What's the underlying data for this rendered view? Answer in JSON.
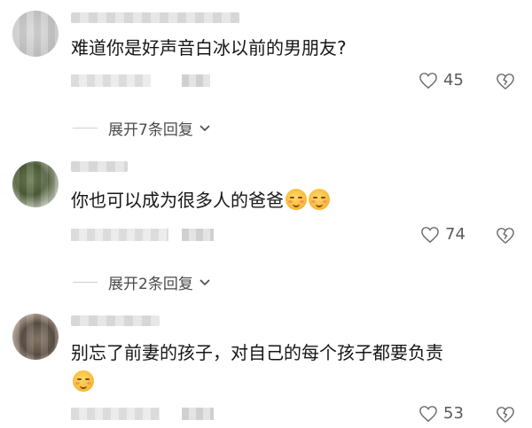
{
  "comments": [
    {
      "text": "难道你是好声音白冰以前的男朋友?",
      "likes": "45",
      "replies_label": "展开7条回复"
    },
    {
      "text": "你也可以成为很多人的爸爸",
      "likes": "74",
      "replies_label": "展开2条回复"
    },
    {
      "text": "别忘了前妻的孩子，对自己的每个孩子都要负责",
      "likes": "53"
    }
  ],
  "icons": {
    "like": "heart-outline-icon",
    "dislike": "broken-heart-icon",
    "expand": "chevron-down-icon"
  }
}
